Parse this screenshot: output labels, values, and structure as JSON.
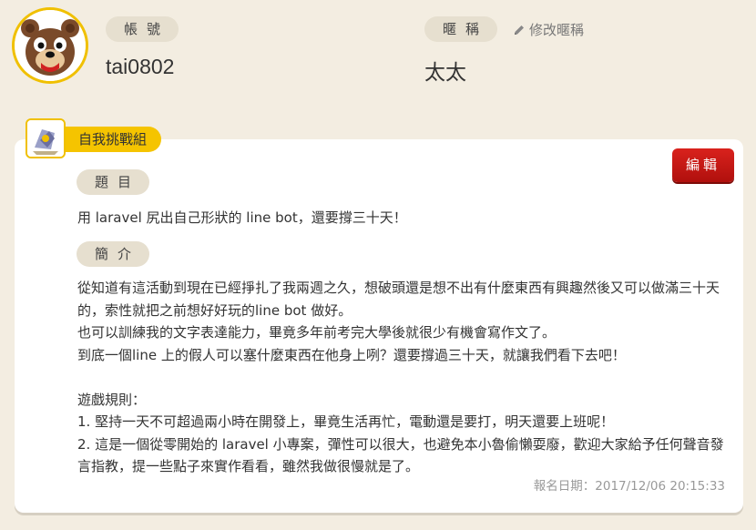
{
  "profile": {
    "account_label": "帳號",
    "account_value": "tai0802",
    "nickname_label": "暱稱",
    "nickname_value": "太太",
    "edit_nickname": "修改暱稱",
    "avatar_icon": "bear-face-icon"
  },
  "group": {
    "name": "自我挑戰組",
    "icon": "group-badge-icon"
  },
  "card": {
    "edit_button": "編輯",
    "title_label": "題目",
    "title_text": "用 laravel 尻出自己形狀的 line bot，還要撐三十天！",
    "intro_label": "簡介",
    "intro_lines": [
      "從知道有這活動到現在已經掙扎了我兩週之久，想破頭還是想不出有什麼東西有興趣然後又可以做滿三十天的，索性就把之前想好好玩的line bot 做好。",
      "也可以訓練我的文字表達能力，畢竟多年前考完大學後就很少有機會寫作文了。",
      "到底一個line 上的假人可以塞什麼東西在他身上咧？還要撐過三十天，就讓我們看下去吧！",
      "",
      "遊戲規則：",
      "1. 堅持一天不可超過兩小時在開發上，畢竟生活再忙，電動還是要打，明天還要上班呢！",
      "2. 這是一個從零開始的 laravel 小專案，彈性可以很大，也避免本小魯偷懶耍廢，歡迎大家給予任何聲音發言指教，提一些點子來實作看看，雖然我做很慢就是了。"
    ],
    "signup_date": "報名日期：2017/12/06 20:15:33"
  },
  "colors": {
    "background": "#f3ede1",
    "pill": "#e6dfcf",
    "accent_yellow": "#f5c400",
    "edit_red": "#c8191a"
  }
}
